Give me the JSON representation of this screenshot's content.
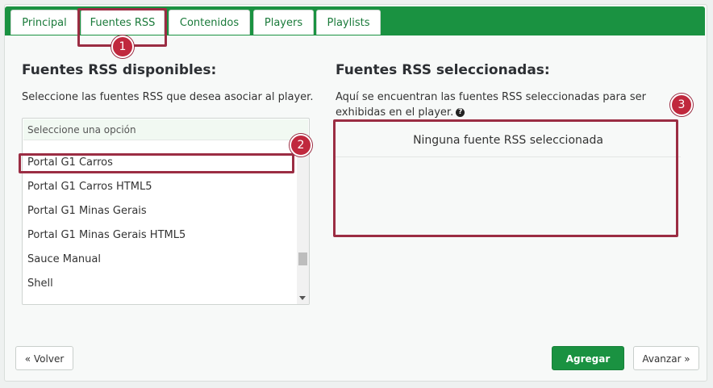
{
  "tabs": [
    {
      "label": "Principal"
    },
    {
      "label": "Fuentes RSS"
    },
    {
      "label": "Contenidos"
    },
    {
      "label": "Players"
    },
    {
      "label": "Playlists"
    }
  ],
  "annotations": [
    "1",
    "2",
    "3"
  ],
  "available": {
    "title": "Fuentes RSS disponibles:",
    "description": "Seleccione las fuentes RSS que desea asociar al player.",
    "search_placeholder": "Seleccione una opción",
    "options": [
      "Portal G1 Carros",
      "Portal G1 Carros HTML5",
      "Portal G1 Minas Gerais",
      "Portal G1 Minas Gerais HTML5",
      "Sauce Manual",
      "Shell"
    ]
  },
  "selected": {
    "title": "Fuentes RSS seleccionadas:",
    "description_line1": "Aquí se encuentran las fuentes RSS seleccionadas para ser",
    "description_line2": "exhibidas en el player.",
    "empty_message": "Ninguna fuente RSS seleccionada"
  },
  "buttons": {
    "back": "« Volver",
    "add": "Agregar",
    "next": "Avanzar »"
  },
  "colors": {
    "brand_green": "#1a9241",
    "annotation": "#9b2d43"
  }
}
